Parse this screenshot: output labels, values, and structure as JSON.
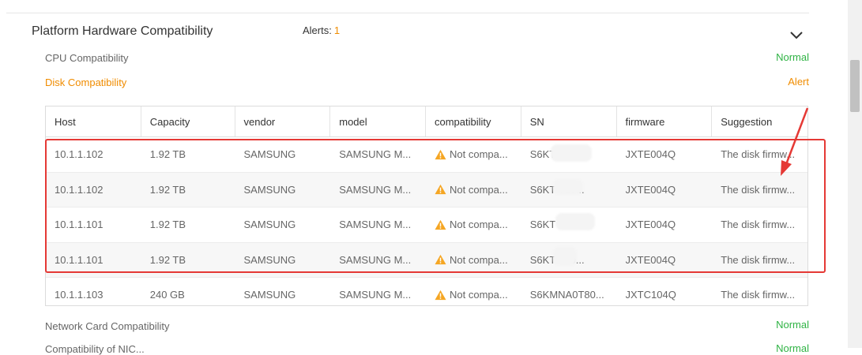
{
  "section": {
    "title": "Platform Hardware Compatibility",
    "alerts_label": "Alerts:",
    "alerts_count": "1"
  },
  "checks": [
    {
      "label": "CPU Compatibility",
      "status": "Normal"
    },
    {
      "label": "Disk Compatibility",
      "status": "Alert"
    },
    {
      "label": "Network Card Compatibility",
      "status": "Normal"
    },
    {
      "label": "Compatibility of NIC...",
      "status": "Normal"
    }
  ],
  "table": {
    "columns": [
      "Host",
      "Capacity",
      "vendor",
      "model",
      "compatibility",
      "SN",
      "firmware",
      "Suggestion"
    ],
    "rows": [
      {
        "host": "10.1.1.102",
        "capacity": "1.92 TB",
        "vendor": "SAMSUNG",
        "model": "SAMSUNG M...",
        "compatibility": "Not compa...",
        "sn": "S6KT      0...",
        "firmware": "JXTE004Q",
        "suggestion": "The disk firmw..."
      },
      {
        "host": "10.1.1.102",
        "capacity": "1.92 TB",
        "vendor": "SAMSUNG",
        "model": "SAMSUNG M...",
        "compatibility": "Not compa...",
        "sn": "S6KT    T10...",
        "firmware": "JXTE004Q",
        "suggestion": "The disk firmw..."
      },
      {
        "host": "10.1.1.101",
        "capacity": "1.92 TB",
        "vendor": "SAMSUNG",
        "model": "SAMSUNG M...",
        "compatibility": "Not compa...",
        "sn": "S6KT          ",
        "firmware": "JXTE004Q",
        "suggestion": "The disk firmw..."
      },
      {
        "host": "10.1.1.101",
        "capacity": "1.92 TB",
        "vendor": "SAMSUNG",
        "model": "SAMSUNG M...",
        "compatibility": "Not compa...",
        "sn": "S6KT    T10...",
        "firmware": "JXTE004Q",
        "suggestion": "The disk firmw..."
      },
      {
        "host": "10.1.1.103",
        "capacity": "240 GB",
        "vendor": "SAMSUNG",
        "model": "SAMSUNG M...",
        "compatibility": "Not compa...",
        "sn": "S6KMNA0T80...",
        "firmware": "JXTC104Q",
        "suggestion": "The disk firmw..."
      }
    ]
  },
  "colors": {
    "alert": "#f08c00",
    "normal": "#2fb344",
    "highlight": "#e53935",
    "warning_icon": "#f5a623"
  },
  "icons": {
    "expand": "chevron-down-icon",
    "warning": "warning-triangle-icon"
  }
}
